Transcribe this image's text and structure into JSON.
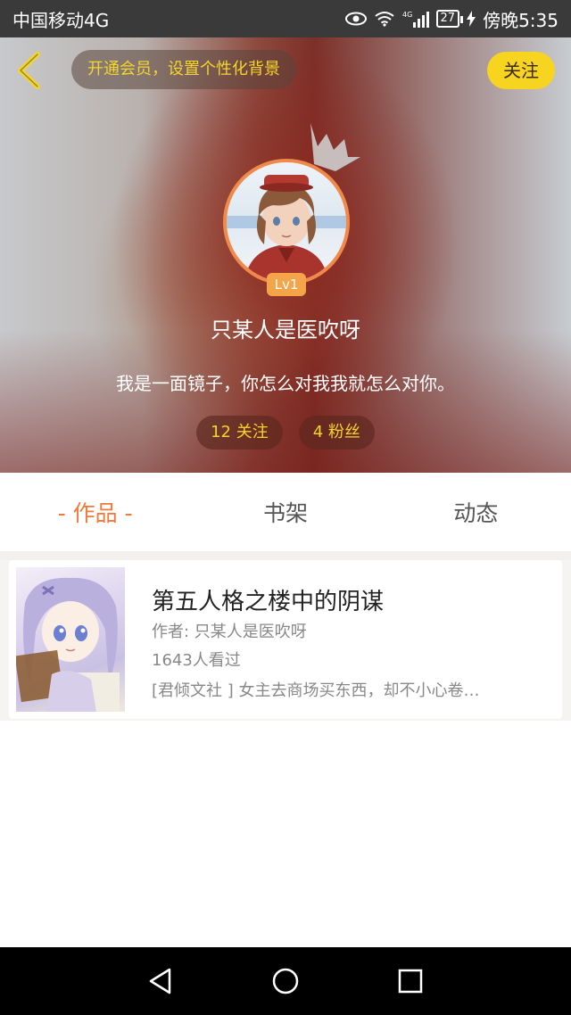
{
  "status_bar": {
    "carrier": "中国移动4G",
    "network": "4G",
    "battery": "27",
    "time": "傍晚5:35"
  },
  "header": {
    "vip_banner": "开通会员，设置个性化背景",
    "follow_label": "关注",
    "level": "Lv1",
    "username": "只某人是医吹呀",
    "bio": "我是一面镜子，你怎么对我我就怎么对你。",
    "following": "12 关注",
    "followers": "4 粉丝"
  },
  "tabs": [
    {
      "label": "- 作品 -",
      "active": true
    },
    {
      "label": "书架",
      "active": false
    },
    {
      "label": "动态",
      "active": false
    }
  ],
  "books": [
    {
      "title": "第五人格之楼中的阴谋",
      "author": "作者: 只某人是医吹呀",
      "views": "1643人看过",
      "description": "[君倾文社 ] 女主去商场买东西，却不小心卷…"
    }
  ],
  "colors": {
    "accent_yellow": "#f7d41f",
    "tab_active": "#f07a3a",
    "level_badge": "#f4a54a"
  },
  "icons": {
    "back": "chevron-left-icon",
    "crown": "crown-icon",
    "nav_back": "triangle-back-icon",
    "nav_home": "circle-home-icon",
    "nav_recent": "square-recent-icon"
  }
}
